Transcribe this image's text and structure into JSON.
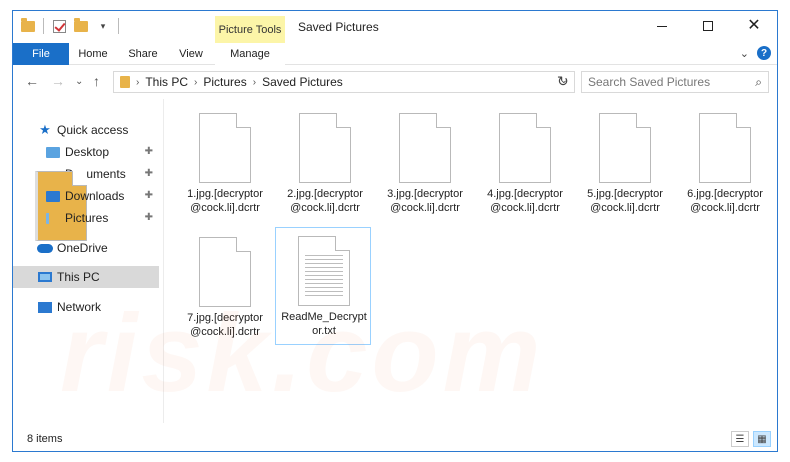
{
  "window": {
    "title": "Saved Pictures",
    "picture_tools_label": "Picture Tools"
  },
  "ribbon": {
    "tabs": [
      {
        "label": "File"
      },
      {
        "label": "Home"
      },
      {
        "label": "Share"
      },
      {
        "label": "View"
      },
      {
        "label": "Manage"
      }
    ]
  },
  "address": {
    "crumbs": [
      "This PC",
      "Pictures",
      "Saved Pictures"
    ],
    "search_placeholder": "Search Saved Pictures"
  },
  "nav": {
    "items": [
      {
        "label": "Quick access"
      },
      {
        "label": "Desktop"
      },
      {
        "label": "Documents"
      },
      {
        "label": "Downloads"
      },
      {
        "label": "Pictures"
      },
      {
        "label": "OneDrive"
      },
      {
        "label": "This PC"
      },
      {
        "label": "Network"
      }
    ]
  },
  "files": [
    {
      "line1": "1.jpg.[decryptor",
      "line2": "@cock.li].dcrtr"
    },
    {
      "line1": "2.jpg.[decryptor",
      "line2": "@cock.li].dcrtr"
    },
    {
      "line1": "3.jpg.[decryptor",
      "line2": "@cock.li].dcrtr"
    },
    {
      "line1": "4.jpg.[decryptor",
      "line2": "@cock.li].dcrtr"
    },
    {
      "line1": "5.jpg.[decryptor",
      "line2": "@cock.li].dcrtr"
    },
    {
      "line1": "6.jpg.[decryptor",
      "line2": "@cock.li].dcrtr"
    },
    {
      "line1": "7.jpg.[decryptor",
      "line2": "@cock.li].dcrtr"
    },
    {
      "line1": "ReadMe_Decrypt",
      "line2": "or.txt"
    }
  ],
  "status": {
    "item_count": "8 items"
  },
  "watermark": "risk.com",
  "colors": {
    "accent": "#1a6fc8",
    "picture_tools": "#fcf5a8",
    "selection": "#d9d9d9"
  }
}
